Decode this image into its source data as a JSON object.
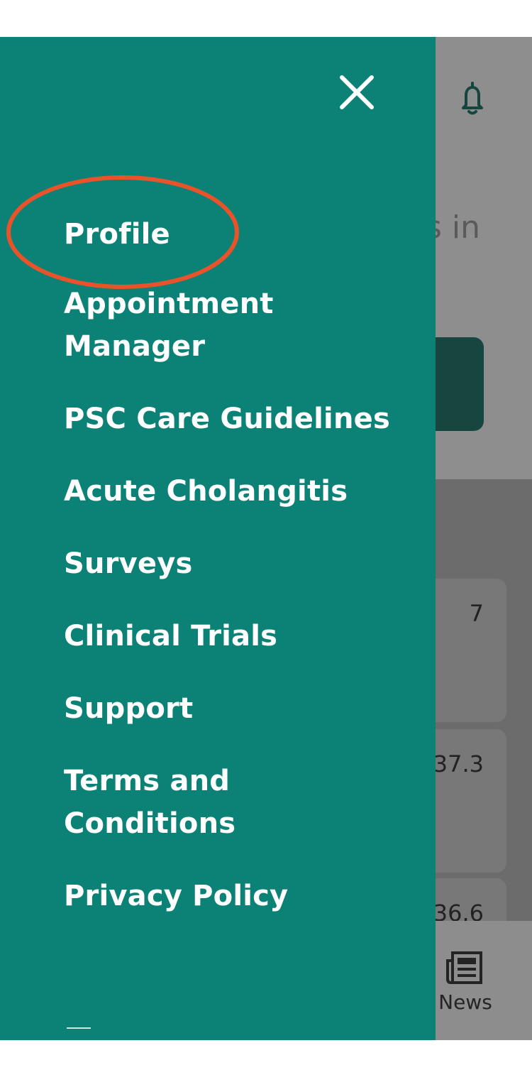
{
  "drawer": {
    "menu": [
      {
        "id": "profile",
        "label": "Profile"
      },
      {
        "id": "appointment-manager",
        "label": "Appointment Manager"
      },
      {
        "id": "psc-care-guidelines",
        "label": "PSC Care Guidelines"
      },
      {
        "id": "acute-cholangitis",
        "label": "Acute Cholangitis"
      },
      {
        "id": "surveys",
        "label": "Surveys"
      },
      {
        "id": "clinical-trials",
        "label": "Clinical Trials"
      },
      {
        "id": "support",
        "label": "Support"
      },
      {
        "id": "terms-and-conditions",
        "label": "Terms and Conditions"
      },
      {
        "id": "privacy-policy",
        "label": "Privacy Policy"
      }
    ],
    "close_icon": "close-icon"
  },
  "background": {
    "heading_fragment": "s in",
    "card_values": [
      "7",
      "37.3",
      "36.6"
    ],
    "bell_icon": "bell-icon",
    "tab_news_label": "News",
    "tab_news_icon": "newspaper-icon"
  },
  "colors": {
    "drawer": "#0c8276",
    "highlight": "#e8532a",
    "overlay": "#8d8d8d",
    "accent_dark": "#16463f"
  },
  "annotation": {
    "highlighted_item": "Profile"
  }
}
